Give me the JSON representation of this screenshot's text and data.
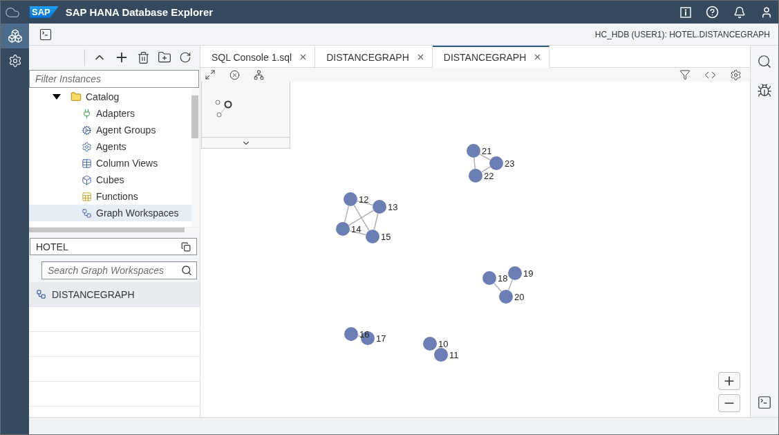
{
  "app": {
    "logo": "SAP",
    "title": "SAP HANA Database Explorer"
  },
  "rail": [
    {
      "kind": "explorer",
      "selected": true
    },
    {
      "kind": "settings",
      "selected": false
    }
  ],
  "context": "HC_HDB (USER1): HOTEL.DISTANCEGRAPH",
  "filter": {
    "placeholder": "Filter Instances"
  },
  "tree": [
    {
      "label": "Catalog",
      "expanded": true,
      "children": [
        {
          "label": "Adapters",
          "kind": "adapter",
          "selected": false
        },
        {
          "label": "Agent Groups",
          "kind": "gears",
          "selected": false
        },
        {
          "label": "Agents",
          "kind": "gear",
          "selected": false
        },
        {
          "label": "Column Views",
          "kind": "table",
          "selected": false
        },
        {
          "label": "Cubes",
          "kind": "cube",
          "selected": false
        },
        {
          "label": "Functions",
          "kind": "function",
          "selected": false
        },
        {
          "label": "Graph Workspaces",
          "kind": "graph",
          "selected": true
        }
      ]
    }
  ],
  "schema": {
    "value": "HOTEL"
  },
  "search": {
    "placeholder": "Search Graph Workspaces"
  },
  "workspaces": [
    {
      "label": "DISTANCEGRAPH",
      "selected": true
    }
  ],
  "tabs": [
    {
      "label": "SQL Console 1.sql",
      "selected": false
    },
    {
      "label": "DISTANCEGRAPH",
      "selected": false
    },
    {
      "label": "DISTANCEGRAPH",
      "selected": true
    }
  ],
  "graph": {
    "clusters": [
      [
        "21",
        "23",
        "22"
      ],
      [
        "12",
        "13",
        "14",
        "15"
      ],
      [
        "18",
        "19",
        "20"
      ],
      [
        "16",
        "17"
      ],
      [
        "10",
        "11"
      ]
    ]
  }
}
